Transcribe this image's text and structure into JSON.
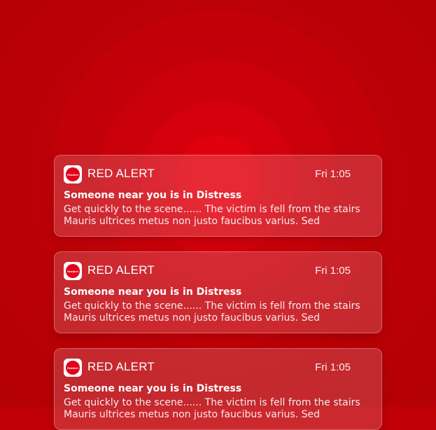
{
  "notifications": [
    {
      "app_name": "RED ALERT",
      "app_icon": "red-alert-logo-icon",
      "icon_text": "RedAlert",
      "time": "Fri 1:05",
      "title": "Someone near you is in Distress",
      "body_line1": "Get quickly to the scene...... The victim is fell from the stairs",
      "body_line2": "Mauris ultrices metus non justo faucibus varius. Sed"
    },
    {
      "app_name": "RED ALERT",
      "app_icon": "red-alert-logo-icon",
      "icon_text": "RedAlert",
      "time": "Fri 1:05",
      "title": "Someone near you is in Distress",
      "body_line1": "Get quickly to the scene...... The victim is fell from the stairs",
      "body_line2": "Mauris ultrices metus non justo faucibus varius. Sed"
    },
    {
      "app_name": "RED ALERT",
      "app_icon": "red-alert-logo-icon",
      "icon_text": "RedAlert",
      "time": "Fri 1:05",
      "title": "Someone near you is in Distress",
      "body_line1": "Get quickly to the scene...... The victim is fell from the stairs",
      "body_line2": "Mauris ultrices metus non justo faucibus varius. Sed"
    }
  ],
  "colors": {
    "background": "#c10006",
    "accent": "#e3001a",
    "text": "#ffffff"
  }
}
